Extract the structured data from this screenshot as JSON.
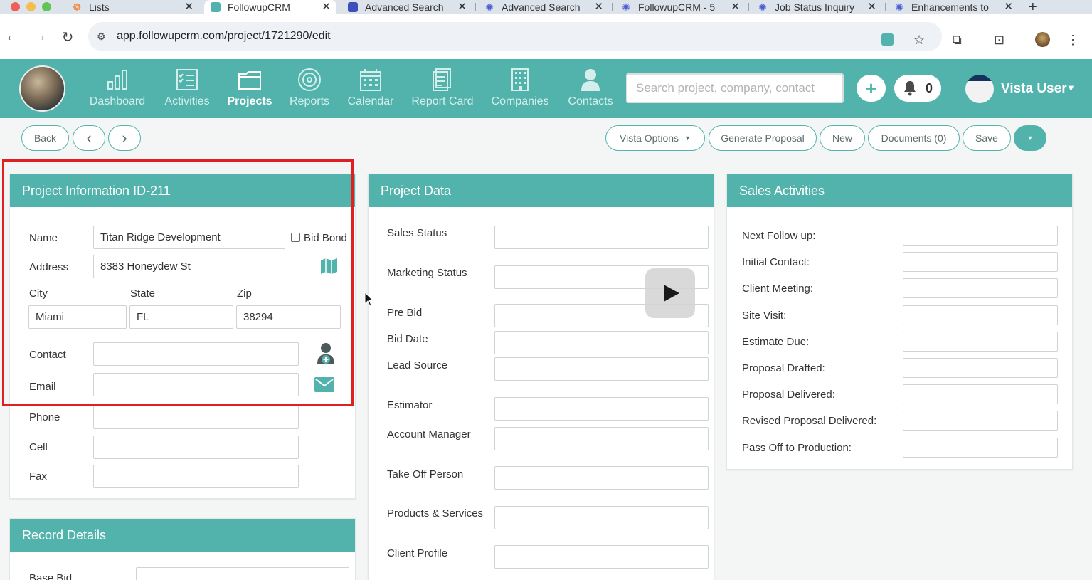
{
  "browser": {
    "tabs": [
      {
        "title": "Lists",
        "icon": "hubspot-icon"
      },
      {
        "title": "FollowupCRM",
        "icon": "followupcrm-icon",
        "active": true
      },
      {
        "title": "Advanced Search",
        "icon": "search-app-icon"
      },
      {
        "title": "Advanced Search",
        "icon": "snowflake-icon"
      },
      {
        "title": "FollowupCRM - 5",
        "icon": "snowflake-icon"
      },
      {
        "title": "Job Status Inquiry",
        "icon": "snowflake-icon"
      },
      {
        "title": "Enhancements to",
        "icon": "snowflake-icon"
      }
    ],
    "new_tab": "+",
    "url": "app.followupcrm.com/project/1721290/edit"
  },
  "app": {
    "nav": [
      {
        "label": "Dashboard",
        "icon": "bar-chart-icon"
      },
      {
        "label": "Activities",
        "icon": "checklist-icon"
      },
      {
        "label": "Projects",
        "icon": "folder-icon",
        "active": true
      },
      {
        "label": "Reports",
        "icon": "target-icon"
      },
      {
        "label": "Calendar",
        "icon": "calendar-icon"
      },
      {
        "label": "Report Card",
        "icon": "report-card-icon"
      },
      {
        "label": "Companies",
        "icon": "building-icon"
      },
      {
        "label": "Contacts",
        "icon": "person-icon"
      }
    ],
    "search_placeholder": "Search project, company, contact",
    "add_label": "+",
    "notifications_count": "0",
    "user_name": "Vista User"
  },
  "toolbar": {
    "back": "Back",
    "prev": "‹",
    "next": "›",
    "vista_options": "Vista Options",
    "generate_proposal": "Generate Proposal",
    "new": "New",
    "documents": "Documents (0)",
    "save": "Save"
  },
  "project_info": {
    "title": "Project Information ID-211",
    "name_label": "Name",
    "name_value": "Titan Ridge Development",
    "bid_bond_label": "Bid Bond",
    "address_label": "Address",
    "address_value": "8383 Honeydew St",
    "city_label": "City",
    "state_label": "State",
    "zip_label": "Zip",
    "city_value": "Miami",
    "state_value": "FL",
    "zip_value": "38294",
    "contact_label": "Contact",
    "email_label": "Email",
    "phone_label": "Phone",
    "cell_label": "Cell",
    "fax_label": "Fax"
  },
  "record_details": {
    "title": "Record Details",
    "base_bid_label": "Base Bid"
  },
  "project_data": {
    "title": "Project Data",
    "fields": [
      "Sales Status",
      "Marketing Status",
      "Pre Bid",
      "Bid Date",
      "Lead Source",
      "Estimator",
      "Account Manager",
      "Take Off Person",
      "Products & Services",
      "Client Profile"
    ]
  },
  "sales_activities": {
    "title": "Sales Activities",
    "fields": [
      "Next Follow up:",
      "Initial Contact:",
      "Client Meeting:",
      "Site Visit:",
      "Estimate Due:",
      "Proposal Drafted:",
      "Proposal Delivered:",
      "Revised Proposal Delivered:",
      "Pass Off to Production:"
    ]
  },
  "colors": {
    "brand_teal": "#52b3ad",
    "highlight_red": "#e02020"
  }
}
